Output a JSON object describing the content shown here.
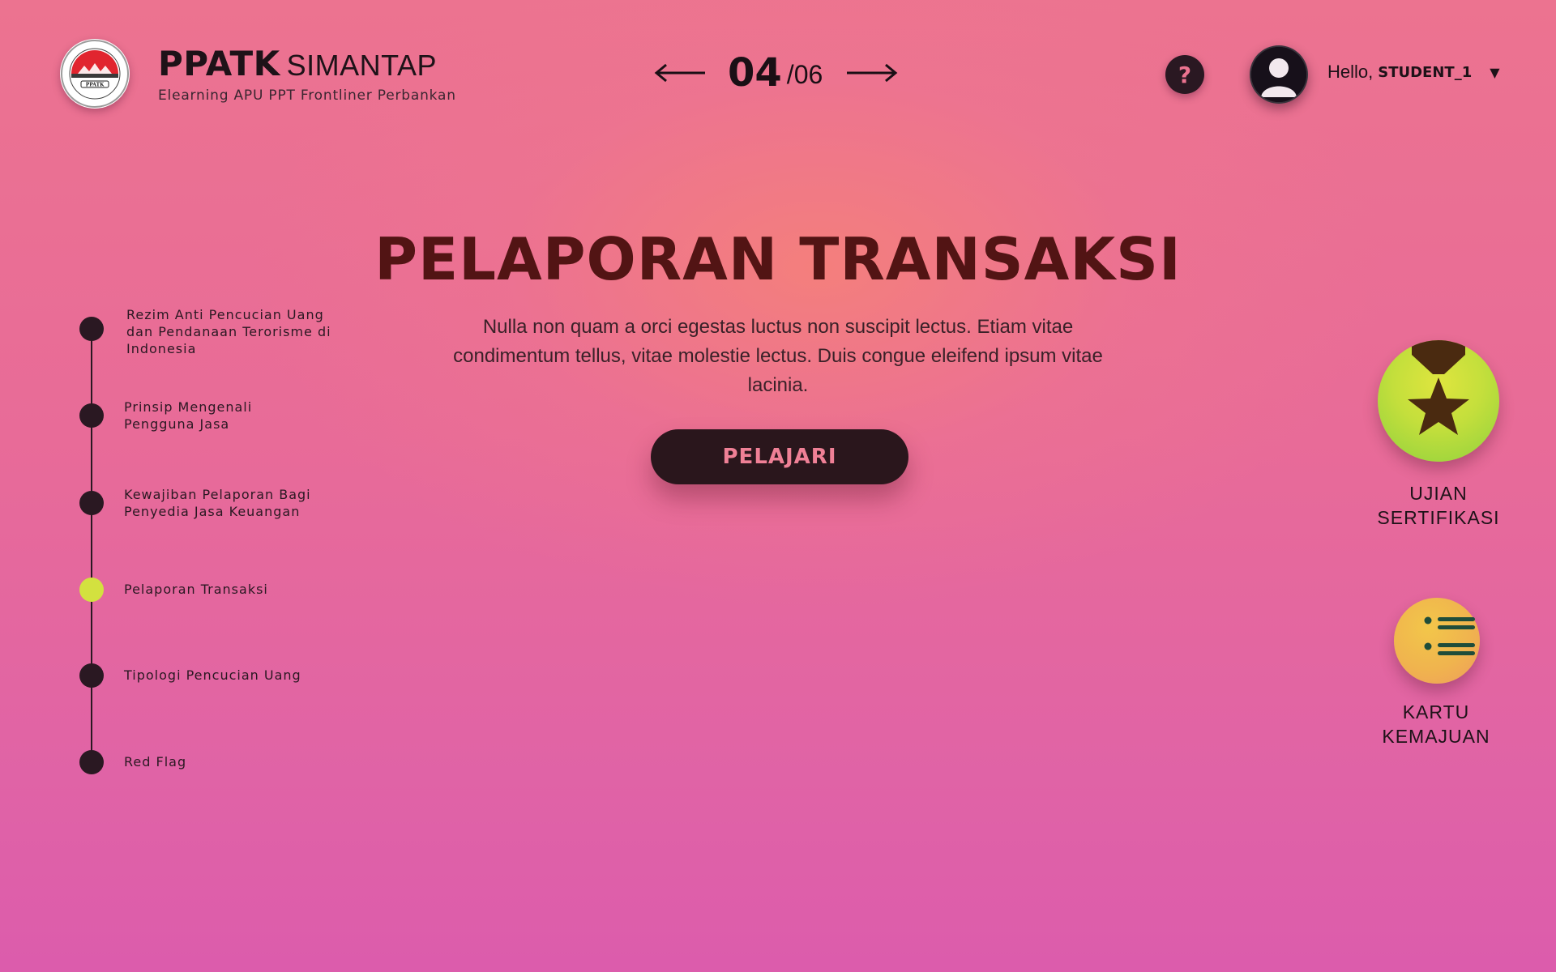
{
  "header": {
    "brand_bold": "PPATK",
    "brand_light": "SIMANTAP",
    "brand_subtitle": "Elearning APU PPT Frontliner Perbankan",
    "logo_text": "PUSAT PELAPORAN DAN ANALISIS TRANSAKSI KEUANGAN",
    "logo_mark": "PPATK"
  },
  "pager": {
    "current": "04",
    "total": "/06",
    "prev_icon": "arrow-left-icon",
    "next_icon": "arrow-right-icon"
  },
  "help": {
    "label": "?",
    "icon": "question-icon"
  },
  "user": {
    "hello": "Hello,",
    "name": "STUDENT_1",
    "caret": "▼",
    "avatar_icon": "user-avatar-icon"
  },
  "main": {
    "title": "PELAPORAN TRANSAKSI",
    "description": "Nulla non quam a orci egestas luctus non suscipit lectus. Etiam vitae condimentum tellus, vitae molestie lectus. Duis congue eleifend ipsum vitae lacinia.",
    "button_label": "PELAJARI"
  },
  "timeline": {
    "items": [
      {
        "label": "Rezim Anti Pencucian Uang dan Pendanaan Terorisme di Indonesia",
        "active": false
      },
      {
        "label": "Prinsip Mengenali Pengguna Jasa",
        "active": false
      },
      {
        "label": "Kewajiban Pelaporan Bagi Penyedia Jasa Keuangan",
        "active": false
      },
      {
        "label": "Pelaporan Transaksi",
        "active": true
      },
      {
        "label": "Tipologi Pencucian Uang",
        "active": false
      },
      {
        "label": "Red Flag",
        "active": false
      }
    ]
  },
  "actions": {
    "certification": {
      "line1": "UJIAN",
      "line2": "SERTIFIKASI",
      "icon": "medal-star-icon"
    },
    "progress": {
      "line1": "KARTU",
      "line2": "KEMAJUAN",
      "icon": "list-icon"
    }
  },
  "colors": {
    "background_top": "#ec7390",
    "background_bottom": "#dc5cac",
    "title": "#521414",
    "dark": "#2a1822",
    "active_dot": "#d3e13f",
    "button_text": "#ef8096",
    "medal_green": "#8fd13e",
    "progress_yellow": "#f0b44e"
  }
}
